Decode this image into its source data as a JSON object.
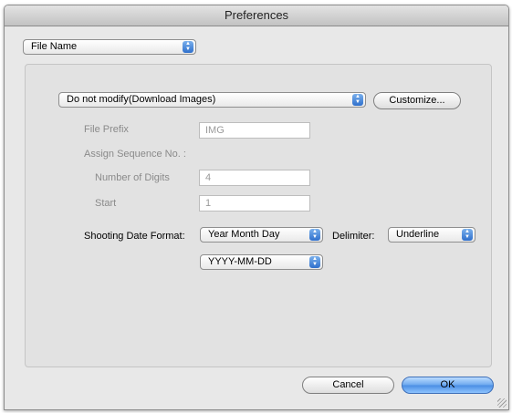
{
  "window": {
    "title": "Preferences"
  },
  "category_popup": {
    "selected": "File Name"
  },
  "rename_popup": {
    "selected": "Do not modify(Download Images)"
  },
  "customize_button": {
    "label": "Customize..."
  },
  "file_prefix": {
    "label": "File Prefix",
    "value": "IMG"
  },
  "sequence": {
    "label": "Assign Sequence No. :",
    "digits_label": "Number of Digits",
    "digits_value": "4",
    "start_label": "Start",
    "start_value": "1"
  },
  "shooting_date": {
    "label": "Shooting Date Format:",
    "order_selected": "Year Month Day",
    "delimiter_label": "Delimiter:",
    "delimiter_selected": "Underline",
    "format_selected": "YYYY-MM-DD"
  },
  "buttons": {
    "cancel": "Cancel",
    "ok": "OK"
  },
  "colors": {
    "accent": "#4b8ee4",
    "window_bg": "#e8e8e8",
    "panel_bg": "#e2e2e2"
  }
}
